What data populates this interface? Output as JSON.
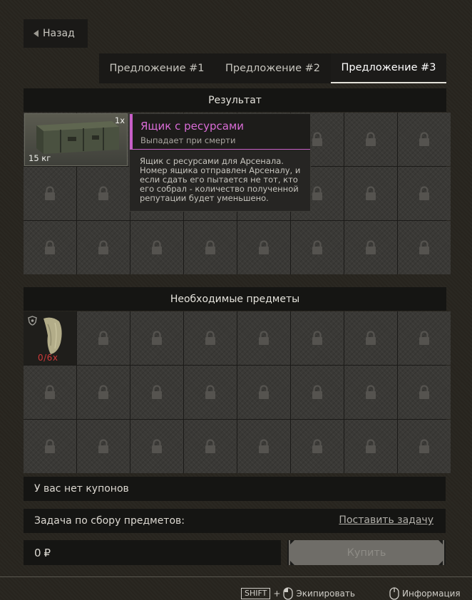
{
  "nav": {
    "back_label": "Назад"
  },
  "tabs": [
    {
      "label": "Предложение #1",
      "active": false
    },
    {
      "label": "Предложение #2",
      "active": false
    },
    {
      "label": "Предложение #3",
      "active": true
    }
  ],
  "result": {
    "header": "Результат",
    "item": {
      "quantity": "1x",
      "weight": "15 кг",
      "icon": "ammo-crate-icon"
    },
    "tooltip": {
      "title": "Ящик с ресурсами",
      "subtitle": "Выпадает при смерти",
      "description": "Ящик с ресурсами для Арсенала. Номер ящика отправлен Арсеналу, и если сдать его пытается не тот, кто его собрал - количество полученной репутации будет уменьшено."
    }
  },
  "required": {
    "header": "Необходимые предметы",
    "item": {
      "count": "0/6x",
      "icon": "cloth-item-icon",
      "badge_icon": "shield-icon"
    }
  },
  "coupons": {
    "text": "У вас нет купонов"
  },
  "task": {
    "label": "Задача по сбору предметов:",
    "action": "Поставить задачу"
  },
  "price": {
    "value": "0",
    "currency": "₽"
  },
  "buy": {
    "label": "Купить"
  },
  "footer": {
    "shift_key": "SHIFT",
    "plus": "+",
    "equip_label": "Экипировать",
    "info_label": "Информация"
  },
  "colors": {
    "rarity_accent": "#c85fc8",
    "shortage_red": "#d03a3a"
  }
}
